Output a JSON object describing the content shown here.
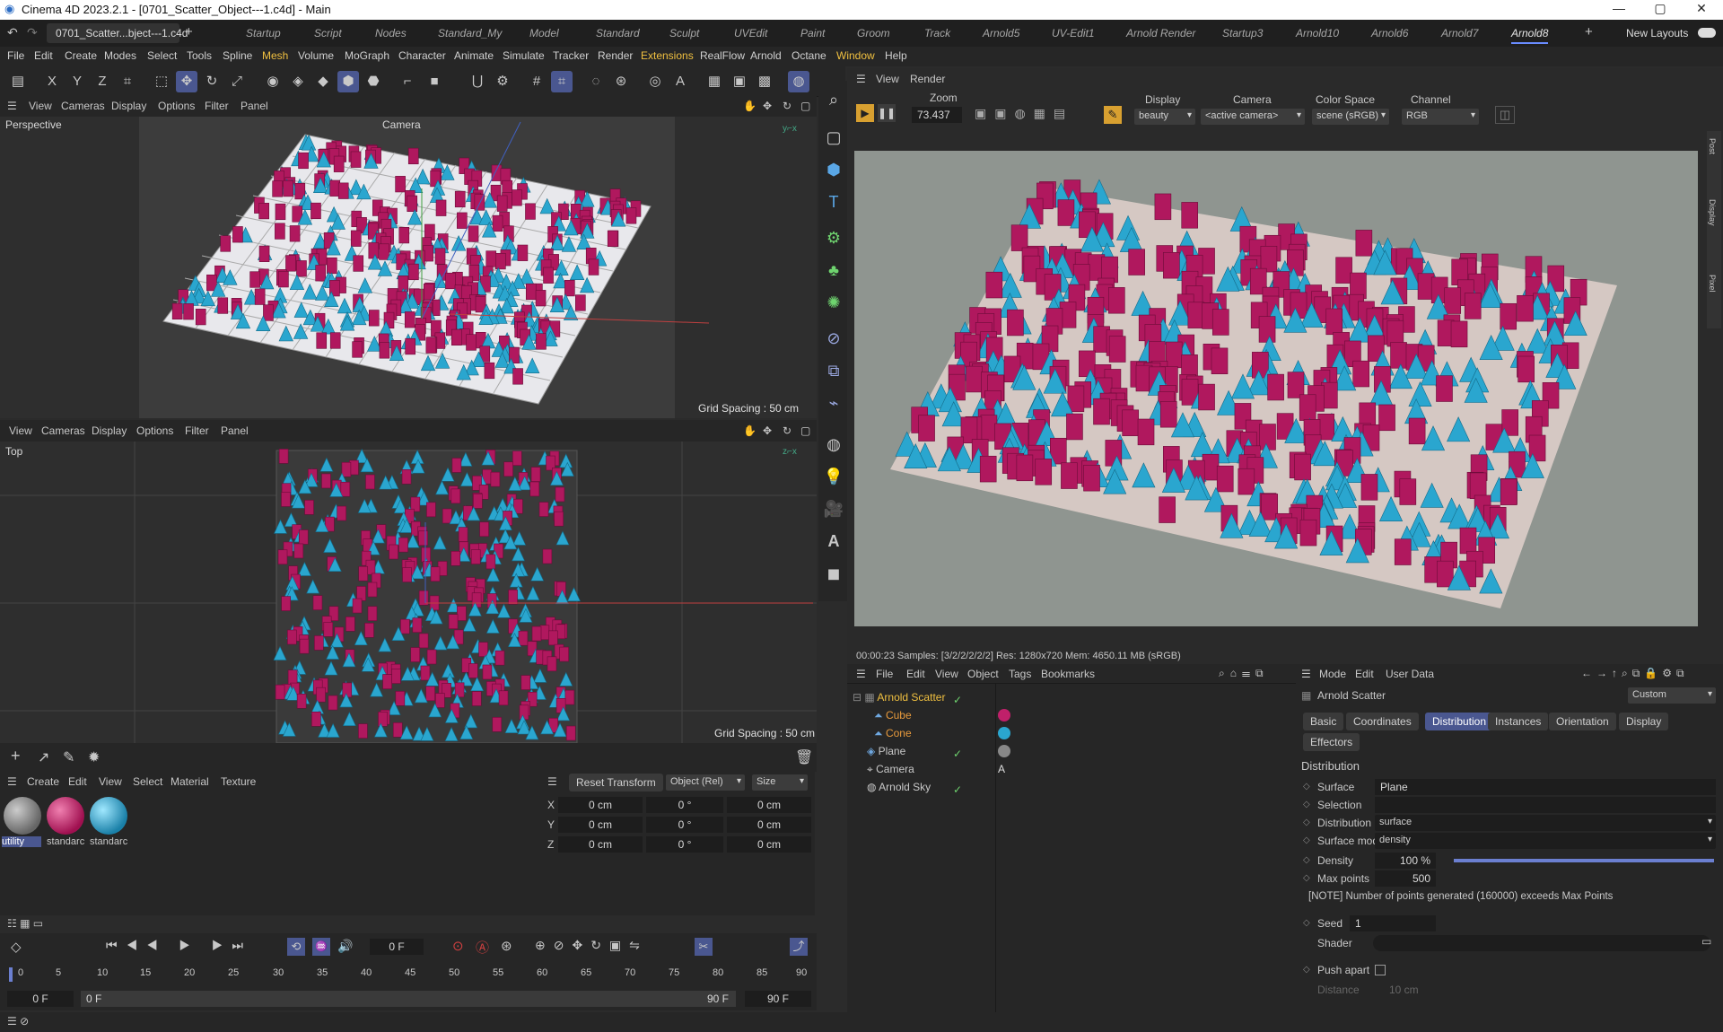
{
  "titlebar": {
    "title": "Cinema 4D 2023.2.1 - [0701_Scatter_Object---1.c4d] - Main",
    "min": "—",
    "max": "▢",
    "close": "✕"
  },
  "layout_tabs": {
    "file_tab": "0701_Scatter...bject---1.c4d",
    "add": "+",
    "tabs": [
      "Startup",
      "Script",
      "Nodes",
      "Standard_My",
      "Model",
      "Standard",
      "Sculpt",
      "UVEdit",
      "Paint",
      "Groom",
      "Track",
      "Arnold5",
      "UV-Edit1",
      "Arnold Render",
      "Startup3",
      "Arnold10",
      "Arnold6",
      "Arnold7",
      "Arnold8"
    ],
    "plus": "+",
    "new_layouts": "New Layouts"
  },
  "menu": [
    "File",
    "Edit",
    "Create",
    "Modes",
    "Select",
    "Tools",
    "Spline",
    "Mesh",
    "Volume",
    "MoGraph",
    "Character",
    "Animate",
    "Simulate",
    "Tracker",
    "Render",
    "Extensions",
    "RealFlow",
    "Arnold",
    "Octane",
    "Window",
    "Help"
  ],
  "viewport_top": {
    "menu": [
      "View",
      "Cameras",
      "Display",
      "Options",
      "Filter",
      "Panel"
    ],
    "label": "Perspective",
    "camera": "Camera",
    "grid": "Grid Spacing : 50 cm"
  },
  "viewport_bottom": {
    "menu": [
      "View",
      "Cameras",
      "Display",
      "Options",
      "Filter",
      "Panel"
    ],
    "label": "Top",
    "grid": "Grid Spacing : 50 cm"
  },
  "render_view": {
    "menu": [
      "View",
      "Render"
    ],
    "zoom_label": "Zoom",
    "zoom_value": "73.437",
    "display_label": "Display",
    "display_value": "beauty",
    "camera_label": "Camera",
    "camera_value": "<active camera>",
    "colorspace_label": "Color Space",
    "colorspace_value": "scene (sRGB)",
    "channel_label": "Channel",
    "channel_value": "RGB",
    "status": "00:00:23  Samples: [3/2/2/2/2/2]  Res: 1280x720  Mem: 4650.11 MB  (sRGB)",
    "side_tabs": [
      "Post",
      "Display",
      "Pixel"
    ]
  },
  "object_manager": {
    "menu": [
      "File",
      "Edit",
      "View",
      "Object",
      "Tags",
      "Bookmarks"
    ],
    "objects": [
      {
        "name": "Arnold Scatter",
        "color": "#f0c040"
      },
      {
        "name": "Cube",
        "color": "#e89a3c"
      },
      {
        "name": "Cone",
        "color": "#e89a3c"
      },
      {
        "name": "Plane",
        "color": "#c8c8c8"
      },
      {
        "name": "Camera",
        "color": "#c8c8c8"
      },
      {
        "name": "Arnold Sky",
        "color": "#c8c8c8"
      }
    ]
  },
  "attributes": {
    "menu": [
      "Mode",
      "Edit",
      "User Data"
    ],
    "object_name": "Arnold Scatter",
    "preset": "Custom",
    "tabs": [
      "Basic",
      "Coordinates",
      "Distribution",
      "Instances",
      "Orientation",
      "Display",
      "Effectors"
    ],
    "active_tab": "Distribution",
    "section": "Distribution",
    "surface_label": "Surface",
    "surface_value": "Plane",
    "selection_label": "Selection",
    "distribution_label": "Distribution",
    "distribution_value": "surface",
    "surface_mode_label": "Surface mode",
    "surface_mode_value": "density",
    "density_label": "Density",
    "density_value": "100 %",
    "density_level": 1.0,
    "max_points_label": "Max points",
    "max_points_value": "500",
    "note": "[NOTE] Number of points generated (160000)  exceeds Max Points",
    "seed_label": "Seed",
    "seed_value": "1",
    "shader_label": "Shader",
    "push_apart_label": "Push apart",
    "distance_label": "Distance",
    "distance_value": "10 cm"
  },
  "materials": {
    "menu": [
      "Create",
      "Edit",
      "View",
      "Select",
      "Material",
      "Texture"
    ],
    "items": [
      {
        "name": "utility",
        "color": "#8a8a8a"
      },
      {
        "name": "standarc",
        "color": "#c0206a"
      },
      {
        "name": "standarc",
        "color": "#2aa6cf"
      }
    ]
  },
  "coords": {
    "reset": "Reset Transform",
    "mode": "Object (Rel)",
    "size": "Size",
    "rows": [
      {
        "axis": "X",
        "p": "0 cm",
        "r": "0 °",
        "s": "0 cm"
      },
      {
        "axis": "Y",
        "p": "0 cm",
        "r": "0 °",
        "s": "0 cm"
      },
      {
        "axis": "Z",
        "p": "0 cm",
        "r": "0 °",
        "s": "0 cm"
      }
    ]
  },
  "timeline": {
    "current_frame": "0 F",
    "ticks": [
      "0",
      "5",
      "10",
      "15",
      "20",
      "25",
      "30",
      "35",
      "40",
      "45",
      "50",
      "55",
      "60",
      "65",
      "70",
      "75",
      "80",
      "85",
      "90"
    ],
    "start": "0 F",
    "start2": "0 F",
    "end": "90 F",
    "end2": "90 F"
  },
  "colors": {
    "accent": "#4a5790",
    "highlight": "#f0c040",
    "magenta": "#b0185e",
    "cyan": "#2aa6cf"
  }
}
